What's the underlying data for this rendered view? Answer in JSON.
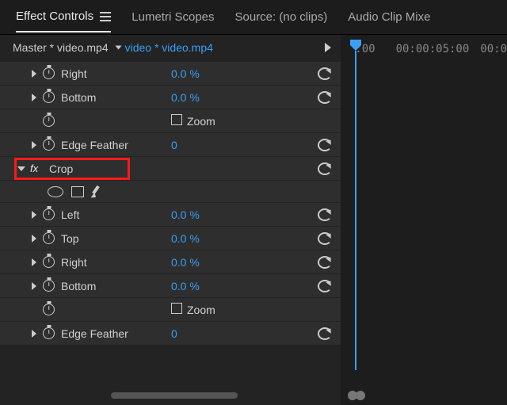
{
  "tabs": {
    "effect_controls": "Effect Controls",
    "lumetri": "Lumetri Scopes",
    "source": "Source: (no clips)",
    "audio_mixer": "Audio Clip Mixe"
  },
  "master": {
    "prefix": "Master * video.mp4",
    "clip": "video * video.mp4"
  },
  "timeline": {
    "t0": ":00",
    "t1": "00:00:05:00",
    "t2": "00:0"
  },
  "group1": {
    "right": {
      "label": "Right",
      "value": "0.0 %"
    },
    "bottom": {
      "label": "Bottom",
      "value": "0.0 %"
    },
    "zoom": {
      "label": "Zoom"
    },
    "edge_feather": {
      "label": "Edge Feather",
      "value": "0"
    }
  },
  "crop": {
    "header": "Crop",
    "left": {
      "label": "Left",
      "value": "0.0 %"
    },
    "top": {
      "label": "Top",
      "value": "0.0 %"
    },
    "right": {
      "label": "Right",
      "value": "0.0 %"
    },
    "bottom": {
      "label": "Bottom",
      "value": "0.0 %"
    },
    "zoom": {
      "label": "Zoom"
    },
    "edge_feather": {
      "label": "Edge Feather",
      "value": "0"
    }
  }
}
